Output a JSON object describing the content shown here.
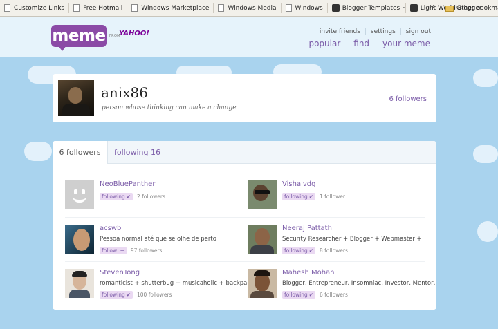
{
  "bookmarks": [
    {
      "label": "Customize Links",
      "icon": "page-icon"
    },
    {
      "label": "Free Hotmail",
      "icon": "page-icon"
    },
    {
      "label": "Windows Marketplace",
      "icon": "page-icon"
    },
    {
      "label": "Windows Media",
      "icon": "page-icon"
    },
    {
      "label": "Windows",
      "icon": "page-icon"
    },
    {
      "label": "Blogger Templates ~ ...",
      "icon": "favicon-icon"
    },
    {
      "label": "Light World Blogger T...",
      "icon": "favicon-icon"
    }
  ],
  "bookmarks_chevron": "»",
  "other_bookmarks": "Other bookmarks",
  "header": {
    "logo_text": "meme",
    "from_text": "FROM",
    "yahoo_text": "YAHOO!",
    "top_links": [
      "invite friends",
      "settings",
      "sign out"
    ],
    "nav": [
      "popular",
      "find",
      "your meme"
    ]
  },
  "profile": {
    "username": "anix86",
    "tagline": "person whose thinking can make a change",
    "followers": "6 followers"
  },
  "tabs": {
    "active": "6 followers",
    "inactive": "following 16"
  },
  "users": [
    {
      "name": "NeoBluePanther",
      "bio": "",
      "badge": "following",
      "badge_mark": "✔",
      "followers": "2 followers",
      "avatar": "default-avatar"
    },
    {
      "name": "Vishalvdg",
      "bio": "",
      "badge": "following",
      "badge_mark": "✔",
      "followers": "1 follower",
      "avatar": "photo"
    },
    {
      "name": "acswb",
      "bio": "Pessoa normal até que se olhe de perto",
      "badge": "follow",
      "badge_mark": "+",
      "followers": "97 followers",
      "avatar": "photo"
    },
    {
      "name": "Neeraj Pattath",
      "bio": "Security Researcher + Blogger + Webmaster +",
      "badge": "following",
      "badge_mark": "✔",
      "followers": "8 followers",
      "avatar": "photo"
    },
    {
      "name": "StevenTong",
      "bio": "romanticist + shutterbug + musicaholic + backpacker",
      "badge": "following",
      "badge_mark": "✔",
      "followers": "100 followers",
      "avatar": "photo"
    },
    {
      "name": "Mahesh Mohan",
      "bio": "Blogger, Entrepreneur, Insomniac, Investor, Mentor,",
      "badge": "following",
      "badge_mark": "✔",
      "followers": "6 followers",
      "avatar": "photo"
    }
  ],
  "colors": {
    "brand": "#8b4aa6",
    "link": "#7b5ca8",
    "sky": "#a9d3ee"
  }
}
